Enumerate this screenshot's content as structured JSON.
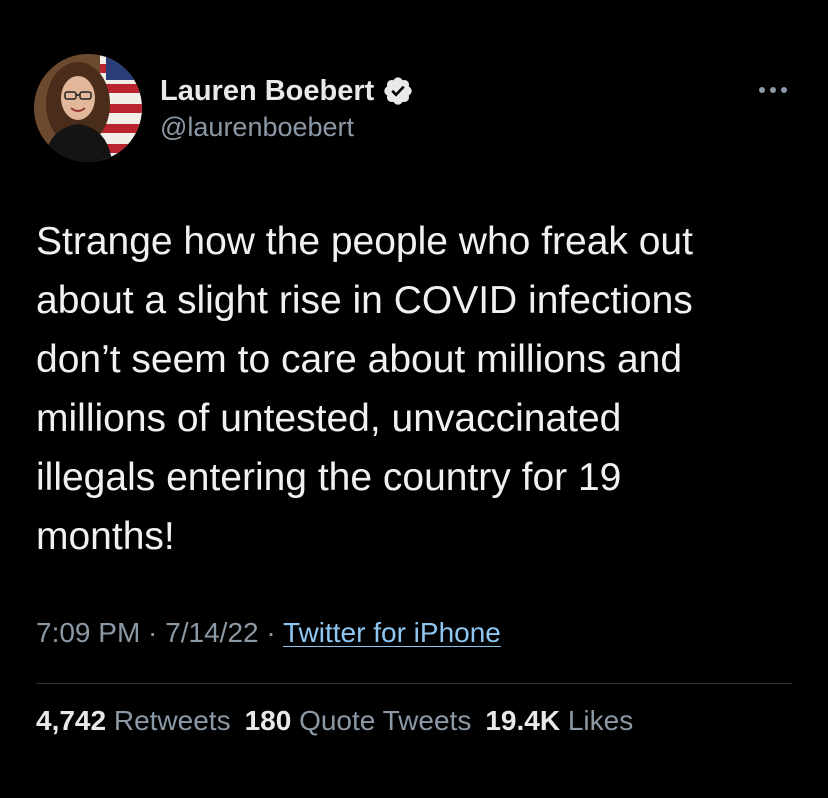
{
  "author": {
    "display_name": "Lauren Boebert",
    "handle": "@laurenboebert",
    "verified": true
  },
  "tweet": {
    "lines": [
      "Strange how the people who freak out",
      "about a slight rise in COVID infections",
      "don’t seem to care about millions and",
      "millions of untested, unvaccinated",
      "illegals entering the country for 19",
      "months!"
    ]
  },
  "meta": {
    "time": "7:09 PM",
    "separator": " · ",
    "date": "7/14/22",
    "source": "Twitter for iPhone"
  },
  "stats": {
    "retweets_count": "4,742",
    "retweets_label": "Retweets",
    "quotes_count": "180",
    "quotes_label": "Quote Tweets",
    "likes_count": "19.4K",
    "likes_label": "Likes"
  },
  "icons": {
    "verified": "verified-badge-icon",
    "more": "more-options-icon"
  },
  "colors": {
    "background": "#000000",
    "primary_text": "#e7e9ea",
    "secondary_text": "#8b98a5",
    "link": "#8ec6f2",
    "divider": "#2f3336"
  }
}
